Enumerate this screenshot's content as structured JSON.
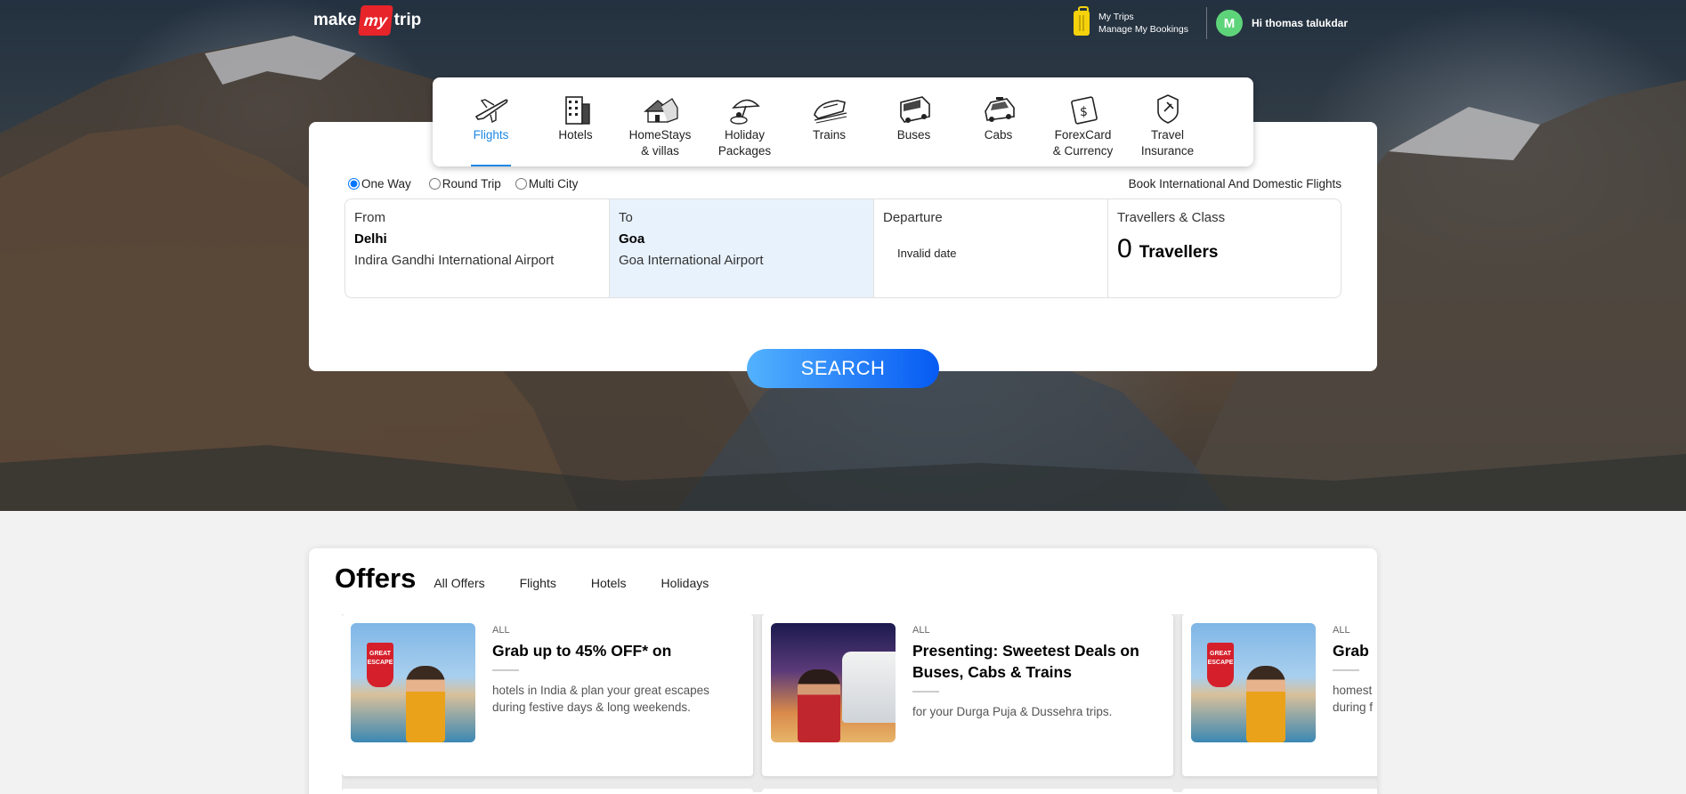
{
  "header": {
    "logo_make": "make",
    "logo_my": "my",
    "logo_trip": "trip",
    "my_trips": "My Trips",
    "manage_bookings": "Manage My Bookings",
    "avatar_initial": "M",
    "greeting": "Hi thomas talukdar"
  },
  "nav": [
    {
      "label": "Flights",
      "icon": "plane-icon"
    },
    {
      "label": "Hotels",
      "icon": "hotel-icon"
    },
    {
      "label": "HomeStays\n& villas",
      "icon": "homestay-icon"
    },
    {
      "label": "Holiday\nPackages",
      "icon": "holiday-icon"
    },
    {
      "label": "Trains",
      "icon": "train-icon"
    },
    {
      "label": "Buses",
      "icon": "bus-icon"
    },
    {
      "label": "Cabs",
      "icon": "cab-icon"
    },
    {
      "label": "ForexCard\n& Currency",
      "icon": "forex-icon"
    },
    {
      "label": "Travel\nInsurance",
      "icon": "insurance-icon"
    }
  ],
  "trip_types": {
    "one_way": "One Way",
    "round_trip": "Round Trip",
    "multi_city": "Multi City",
    "selected": "One Way"
  },
  "book_note": "Book International And Domestic Flights",
  "fields": {
    "from_label": "From",
    "from_city": "Delhi",
    "from_airport": "Indira Gandhi International Airport",
    "to_label": "To",
    "to_city": "Goa",
    "to_airport": "Goa International Airport",
    "departure_label": "Departure",
    "departure_value": "Invalid date",
    "travellers_label": "Travellers & Class",
    "travellers_count": "0",
    "travellers_text": "Travellers"
  },
  "search_label": "SEARCH",
  "offers": {
    "title": "Offers",
    "tabs": [
      "All Offers",
      "Flights",
      "Hotels",
      "Holidays"
    ],
    "cards": [
      {
        "tag": "ALL",
        "title": "Grab up to 45% OFF* on",
        "desc": "hotels in India & plan your great escapes during festive days & long weekends."
      },
      {
        "tag": "ALL",
        "title": "Presenting: Sweetest Deals on Buses, Cabs & Trains",
        "desc": "for your Durga Puja & Dussehra trips."
      },
      {
        "tag": "ALL",
        "title": "Grab",
        "desc": "homest during f"
      }
    ]
  },
  "colors": {
    "accent": "#1e88e5",
    "brand_red": "#e7242a",
    "avatar": "#5ed47a",
    "to_field_bg": "#e8f2fc"
  }
}
